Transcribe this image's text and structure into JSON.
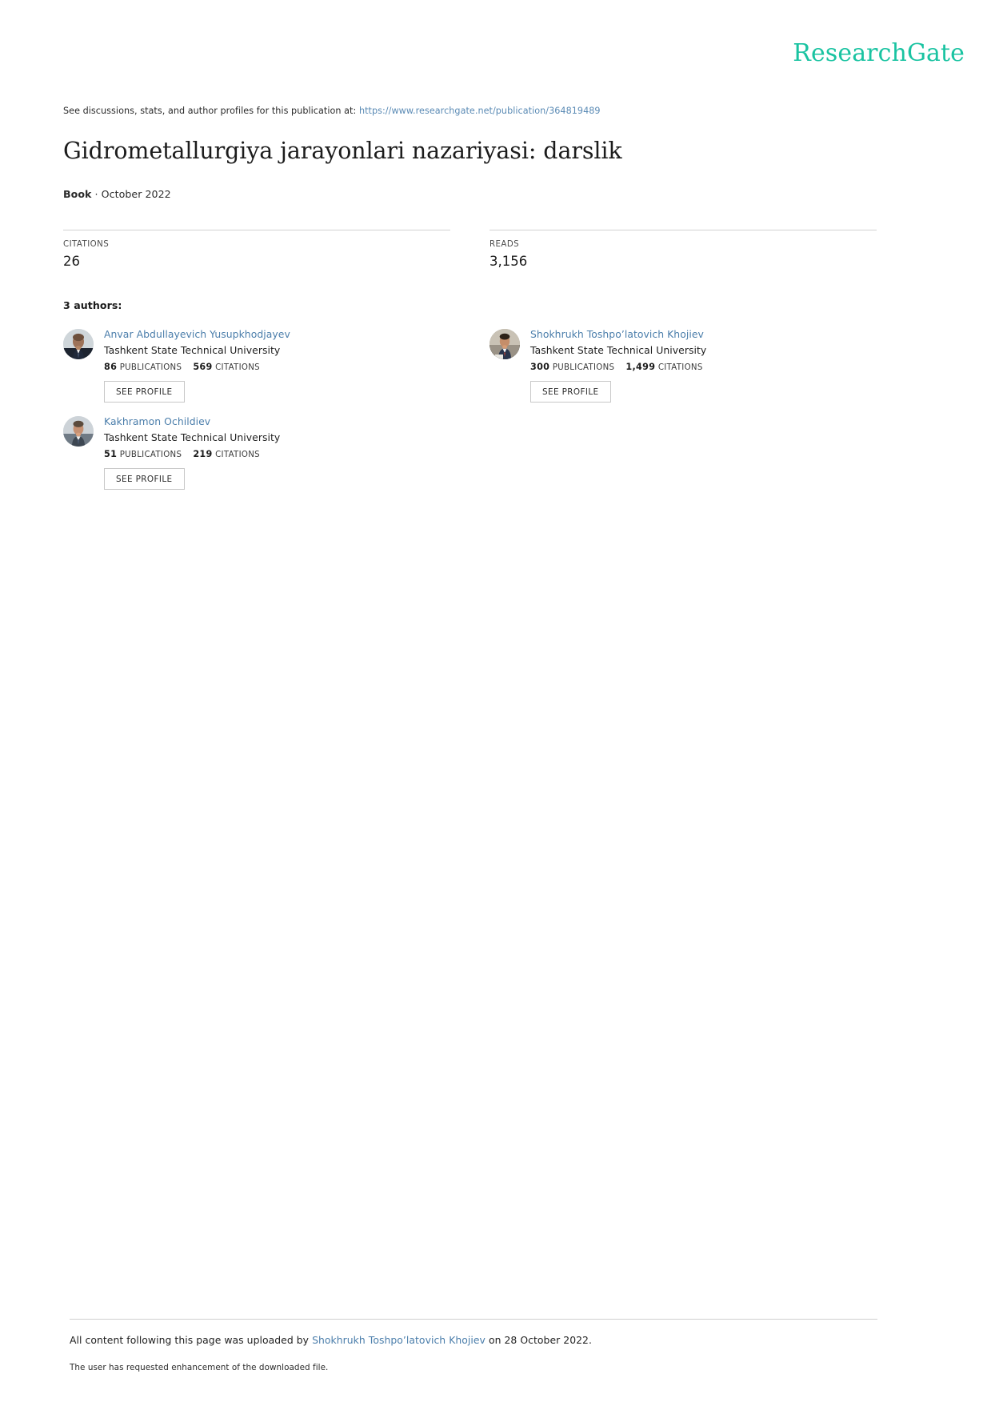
{
  "brand": {
    "logo_text": "ResearchGate",
    "accent_color": "#19c3a1",
    "link_color": "#4b7eab"
  },
  "header": {
    "discussion_prefix": "See discussions, stats, and author profiles for this publication at:",
    "discussion_url": "https://www.researchgate.net/publication/364819489"
  },
  "publication": {
    "title": "Gidrometallurgiya jarayonlari nazariyasi: darslik",
    "type": "Book",
    "separator": "·",
    "date": "October 2022"
  },
  "stats": [
    {
      "label": "CITATIONS",
      "value": "26"
    },
    {
      "label": "READS",
      "value": "3,156"
    }
  ],
  "authors_section": {
    "heading": "3 authors:",
    "see_profile_label": "SEE PROFILE",
    "publications_label": "PUBLICATIONS",
    "citations_label": "CITATIONS",
    "authors": [
      {
        "name": "Anvar Abdullayevich Yusupkhodjayev",
        "affiliation": "Tashkent State Technical University",
        "publications": "86",
        "citations": "569"
      },
      {
        "name": "Shokhrukh Toshpo’latovich Khojiev",
        "affiliation": "Tashkent State Technical University",
        "publications": "300",
        "citations": "1,499"
      },
      {
        "name": "Kakhramon Ochildiev",
        "affiliation": "Tashkent State Technical University",
        "publications": "51",
        "citations": "219"
      }
    ]
  },
  "footer": {
    "upload_prefix": "All content following this page was uploaded by",
    "upload_author": "Shokhrukh Toshpo’latovich Khojiev",
    "upload_suffix": "on 28 October 2022.",
    "enhancement_note": "The user has requested enhancement of the downloaded file."
  }
}
